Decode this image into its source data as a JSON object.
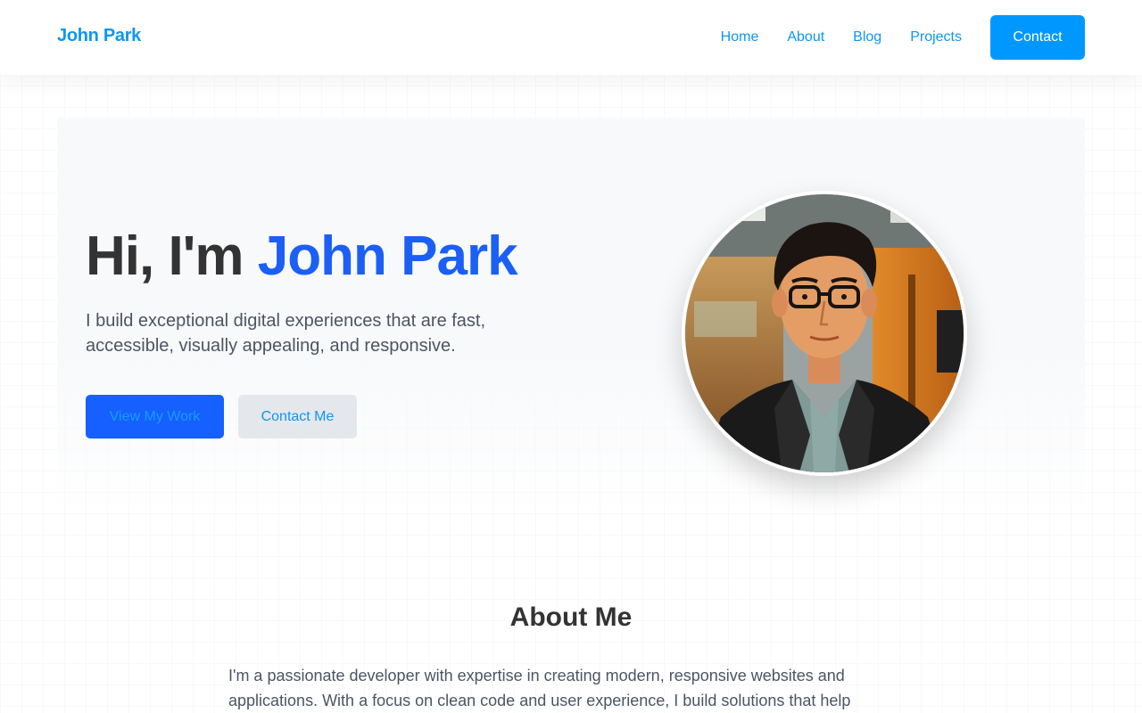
{
  "header": {
    "brand": "John Park",
    "nav": [
      {
        "label": "Home"
      },
      {
        "label": "About"
      },
      {
        "label": "Blog"
      },
      {
        "label": "Projects"
      }
    ],
    "cta_label": "Contact"
  },
  "hero": {
    "greeting": "Hi, I'm",
    "name": "John Park",
    "subtitle": "I build exceptional digital experiences that are fast, accessible, visually appealing, and responsive.",
    "primary_button": "View My Work",
    "secondary_button": "Contact Me"
  },
  "about": {
    "title": "About Me",
    "text": "I'm a passionate developer with expertise in creating modern, responsive websites and applications. With a focus on clean code and user experience, I build solutions that help"
  },
  "colors": {
    "brand": "#0d96f2",
    "accent": "#1b5ff5",
    "primary_button": "#1660ff",
    "cta_button": "#0098ff"
  }
}
